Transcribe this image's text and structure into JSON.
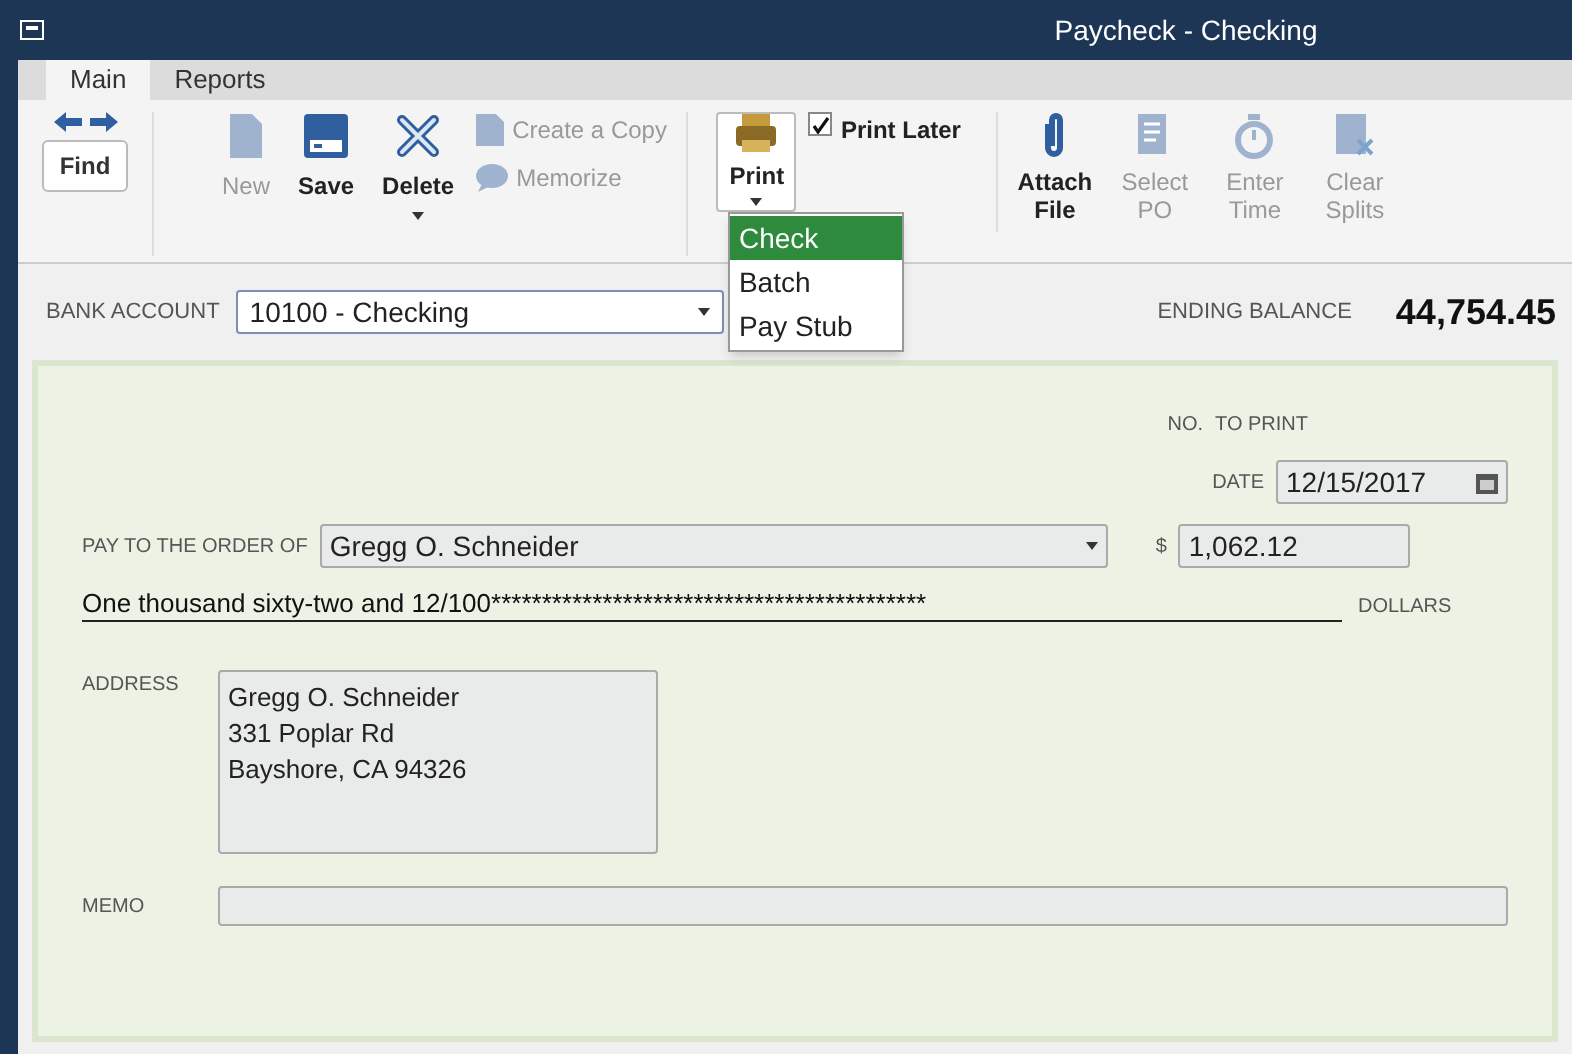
{
  "window": {
    "title": "Paycheck - Checking"
  },
  "tabs": [
    {
      "label": "Main",
      "selected": true
    },
    {
      "label": "Reports",
      "selected": false
    }
  ],
  "toolbar": {
    "find": "Find",
    "items": [
      {
        "kind": "new",
        "label": "New",
        "disabled": true
      },
      {
        "kind": "save",
        "label": "Save",
        "disabled": false
      },
      {
        "kind": "delete",
        "label": "Delete",
        "disabled": false
      }
    ],
    "small_items": [
      {
        "kind": "copy",
        "label": "Create a Copy",
        "disabled": true
      },
      {
        "kind": "memorize",
        "label": "Memorize",
        "disabled": true
      }
    ],
    "print": {
      "label": "Print",
      "expanded": true,
      "menu": [
        {
          "label": "Check",
          "selected": true
        },
        {
          "label": "Batch",
          "selected": false
        },
        {
          "label": "Pay Stub",
          "selected": false
        }
      ]
    },
    "print_later": {
      "label": "Print Later",
      "checked": true
    },
    "right_items": [
      {
        "kind": "attach",
        "label": "Attach File",
        "disabled": false
      },
      {
        "kind": "po",
        "label": "Select PO",
        "disabled": true
      },
      {
        "kind": "time",
        "label": "Enter Time",
        "disabled": true
      },
      {
        "kind": "splits",
        "label": "Clear Splits",
        "disabled": true
      }
    ]
  },
  "bank_account": {
    "label": "BANK ACCOUNT",
    "value": "10100 - Checking"
  },
  "ending_balance": {
    "label": "ENDING BALANCE",
    "value": "44,754.45"
  },
  "check": {
    "no_label": "NO.",
    "no_value": "TO PRINT",
    "date_label": "DATE",
    "date": "12/15/2017",
    "payee_label": "PAY TO THE ORDER OF",
    "payee": "Gregg O. Schneider",
    "amount_label": "$",
    "amount": "1,062.12",
    "amount_words": "One thousand sixty-two and 12/100*******************************************",
    "dollars_label": "DOLLARS",
    "address_label": "ADDRESS",
    "address": [
      "Gregg O. Schneider",
      "331 Poplar Rd",
      "Bayshore, CA 94326"
    ],
    "memo_label": "MEMO"
  }
}
